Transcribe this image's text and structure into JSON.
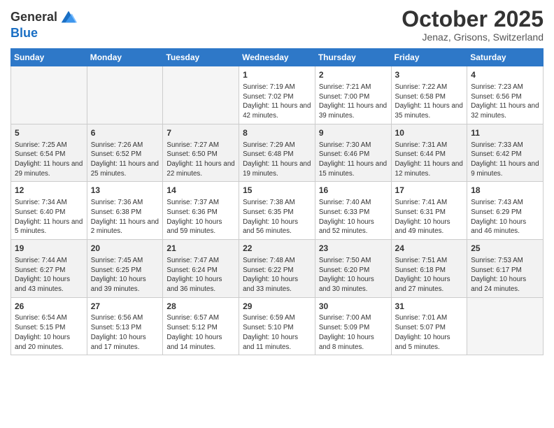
{
  "header": {
    "logo_general": "General",
    "logo_blue": "Blue",
    "month": "October 2025",
    "location": "Jenaz, Grisons, Switzerland"
  },
  "days_of_week": [
    "Sunday",
    "Monday",
    "Tuesday",
    "Wednesday",
    "Thursday",
    "Friday",
    "Saturday"
  ],
  "weeks": [
    [
      {
        "day": "",
        "sunrise": "",
        "sunset": "",
        "daylight": ""
      },
      {
        "day": "",
        "sunrise": "",
        "sunset": "",
        "daylight": ""
      },
      {
        "day": "",
        "sunrise": "",
        "sunset": "",
        "daylight": ""
      },
      {
        "day": "1",
        "sunrise": "Sunrise: 7:19 AM",
        "sunset": "Sunset: 7:02 PM",
        "daylight": "Daylight: 11 hours and 42 minutes."
      },
      {
        "day": "2",
        "sunrise": "Sunrise: 7:21 AM",
        "sunset": "Sunset: 7:00 PM",
        "daylight": "Daylight: 11 hours and 39 minutes."
      },
      {
        "day": "3",
        "sunrise": "Sunrise: 7:22 AM",
        "sunset": "Sunset: 6:58 PM",
        "daylight": "Daylight: 11 hours and 35 minutes."
      },
      {
        "day": "4",
        "sunrise": "Sunrise: 7:23 AM",
        "sunset": "Sunset: 6:56 PM",
        "daylight": "Daylight: 11 hours and 32 minutes."
      }
    ],
    [
      {
        "day": "5",
        "sunrise": "Sunrise: 7:25 AM",
        "sunset": "Sunset: 6:54 PM",
        "daylight": "Daylight: 11 hours and 29 minutes."
      },
      {
        "day": "6",
        "sunrise": "Sunrise: 7:26 AM",
        "sunset": "Sunset: 6:52 PM",
        "daylight": "Daylight: 11 hours and 25 minutes."
      },
      {
        "day": "7",
        "sunrise": "Sunrise: 7:27 AM",
        "sunset": "Sunset: 6:50 PM",
        "daylight": "Daylight: 11 hours and 22 minutes."
      },
      {
        "day": "8",
        "sunrise": "Sunrise: 7:29 AM",
        "sunset": "Sunset: 6:48 PM",
        "daylight": "Daylight: 11 hours and 19 minutes."
      },
      {
        "day": "9",
        "sunrise": "Sunrise: 7:30 AM",
        "sunset": "Sunset: 6:46 PM",
        "daylight": "Daylight: 11 hours and 15 minutes."
      },
      {
        "day": "10",
        "sunrise": "Sunrise: 7:31 AM",
        "sunset": "Sunset: 6:44 PM",
        "daylight": "Daylight: 11 hours and 12 minutes."
      },
      {
        "day": "11",
        "sunrise": "Sunrise: 7:33 AM",
        "sunset": "Sunset: 6:42 PM",
        "daylight": "Daylight: 11 hours and 9 minutes."
      }
    ],
    [
      {
        "day": "12",
        "sunrise": "Sunrise: 7:34 AM",
        "sunset": "Sunset: 6:40 PM",
        "daylight": "Daylight: 11 hours and 5 minutes."
      },
      {
        "day": "13",
        "sunrise": "Sunrise: 7:36 AM",
        "sunset": "Sunset: 6:38 PM",
        "daylight": "Daylight: 11 hours and 2 minutes."
      },
      {
        "day": "14",
        "sunrise": "Sunrise: 7:37 AM",
        "sunset": "Sunset: 6:36 PM",
        "daylight": "Daylight: 10 hours and 59 minutes."
      },
      {
        "day": "15",
        "sunrise": "Sunrise: 7:38 AM",
        "sunset": "Sunset: 6:35 PM",
        "daylight": "Daylight: 10 hours and 56 minutes."
      },
      {
        "day": "16",
        "sunrise": "Sunrise: 7:40 AM",
        "sunset": "Sunset: 6:33 PM",
        "daylight": "Daylight: 10 hours and 52 minutes."
      },
      {
        "day": "17",
        "sunrise": "Sunrise: 7:41 AM",
        "sunset": "Sunset: 6:31 PM",
        "daylight": "Daylight: 10 hours and 49 minutes."
      },
      {
        "day": "18",
        "sunrise": "Sunrise: 7:43 AM",
        "sunset": "Sunset: 6:29 PM",
        "daylight": "Daylight: 10 hours and 46 minutes."
      }
    ],
    [
      {
        "day": "19",
        "sunrise": "Sunrise: 7:44 AM",
        "sunset": "Sunset: 6:27 PM",
        "daylight": "Daylight: 10 hours and 43 minutes."
      },
      {
        "day": "20",
        "sunrise": "Sunrise: 7:45 AM",
        "sunset": "Sunset: 6:25 PM",
        "daylight": "Daylight: 10 hours and 39 minutes."
      },
      {
        "day": "21",
        "sunrise": "Sunrise: 7:47 AM",
        "sunset": "Sunset: 6:24 PM",
        "daylight": "Daylight: 10 hours and 36 minutes."
      },
      {
        "day": "22",
        "sunrise": "Sunrise: 7:48 AM",
        "sunset": "Sunset: 6:22 PM",
        "daylight": "Daylight: 10 hours and 33 minutes."
      },
      {
        "day": "23",
        "sunrise": "Sunrise: 7:50 AM",
        "sunset": "Sunset: 6:20 PM",
        "daylight": "Daylight: 10 hours and 30 minutes."
      },
      {
        "day": "24",
        "sunrise": "Sunrise: 7:51 AM",
        "sunset": "Sunset: 6:18 PM",
        "daylight": "Daylight: 10 hours and 27 minutes."
      },
      {
        "day": "25",
        "sunrise": "Sunrise: 7:53 AM",
        "sunset": "Sunset: 6:17 PM",
        "daylight": "Daylight: 10 hours and 24 minutes."
      }
    ],
    [
      {
        "day": "26",
        "sunrise": "Sunrise: 6:54 AM",
        "sunset": "Sunset: 5:15 PM",
        "daylight": "Daylight: 10 hours and 20 minutes."
      },
      {
        "day": "27",
        "sunrise": "Sunrise: 6:56 AM",
        "sunset": "Sunset: 5:13 PM",
        "daylight": "Daylight: 10 hours and 17 minutes."
      },
      {
        "day": "28",
        "sunrise": "Sunrise: 6:57 AM",
        "sunset": "Sunset: 5:12 PM",
        "daylight": "Daylight: 10 hours and 14 minutes."
      },
      {
        "day": "29",
        "sunrise": "Sunrise: 6:59 AM",
        "sunset": "Sunset: 5:10 PM",
        "daylight": "Daylight: 10 hours and 11 minutes."
      },
      {
        "day": "30",
        "sunrise": "Sunrise: 7:00 AM",
        "sunset": "Sunset: 5:09 PM",
        "daylight": "Daylight: 10 hours and 8 minutes."
      },
      {
        "day": "31",
        "sunrise": "Sunrise: 7:01 AM",
        "sunset": "Sunset: 5:07 PM",
        "daylight": "Daylight: 10 hours and 5 minutes."
      },
      {
        "day": "",
        "sunrise": "",
        "sunset": "",
        "daylight": ""
      }
    ]
  ]
}
